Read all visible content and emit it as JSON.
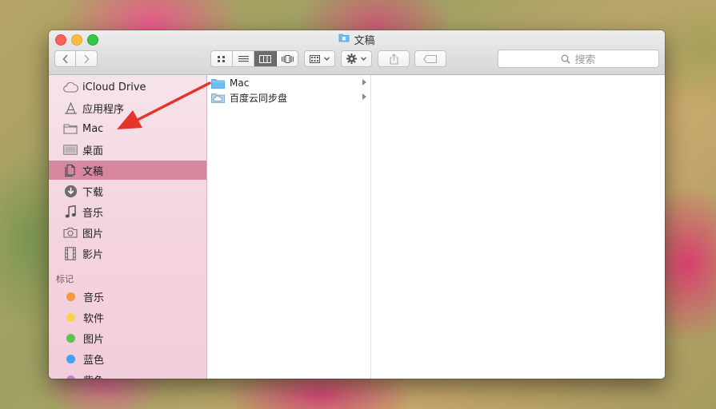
{
  "window": {
    "title": "文稿",
    "title_icon": "folder-icon"
  },
  "toolbar": {
    "back_icon": "chevron-left-icon",
    "forward_icon": "chevron-right-icon",
    "view_icons": [
      "grid-view-icon",
      "list-view-icon",
      "column-view-icon",
      "cover-flow-icon"
    ],
    "selected_view": "column",
    "arrange_icon": "arrange-icon",
    "action_icon": "gear-icon",
    "share_icon": "share-icon",
    "tag_icon": "tag-icon",
    "search": {
      "placeholder": "搜索",
      "icon": "search-icon"
    }
  },
  "sidebar": {
    "favorites": [
      {
        "label": "iCloud Drive",
        "icon": "cloud-icon"
      },
      {
        "label": "应用程序",
        "icon": "applications-icon"
      },
      {
        "label": "Mac",
        "icon": "folder-icon"
      },
      {
        "label": "桌面",
        "icon": "desktop-icon"
      },
      {
        "label": "文稿",
        "icon": "document-icon",
        "selected": true
      },
      {
        "label": "下载",
        "icon": "download-icon"
      },
      {
        "label": "音乐",
        "icon": "music-icon"
      },
      {
        "label": "图片",
        "icon": "camera-icon"
      },
      {
        "label": "影片",
        "icon": "film-icon"
      }
    ],
    "tags_heading": "标记",
    "tags": [
      {
        "label": "音乐",
        "color": "#f7963e"
      },
      {
        "label": "软件",
        "color": "#f8d347"
      },
      {
        "label": "图片",
        "color": "#5ac44e"
      },
      {
        "label": "蓝色",
        "color": "#3fa2f4"
      },
      {
        "label": "紫色",
        "color": "#c17fdc"
      }
    ]
  },
  "columns": {
    "first": [
      {
        "label": "Mac",
        "icon": "folder-icon"
      },
      {
        "label": "百度云同步盘",
        "icon": "cloud-folder-icon"
      }
    ]
  },
  "colors": {
    "sidebar_selection": "#d8889e",
    "annotation_arrow": "#e5352b",
    "folder": "#6fbdf2"
  }
}
